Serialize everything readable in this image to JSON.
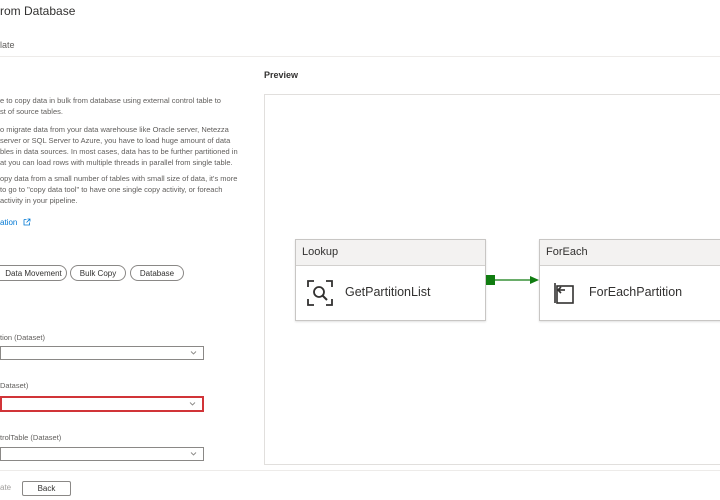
{
  "header": {
    "title": "rom Database",
    "subtitle": "late"
  },
  "description": {
    "lines": [
      "e to copy data in bulk from database using external control table to",
      "st of source tables.",
      "",
      "o migrate data from your data warehouse like Oracle server, Netezza",
      "server or SQL Server to Azure, you have to load huge amount of data",
      "bles in data sources. In most cases, data has to be further partitioned in",
      "at you can load rows with multiple threads in parallel from single table.",
      "",
      "opy data from a small number of tables with small size of data, it's more",
      "to go to \"copy data tool\" to have one single copy activity, or foreach",
      "activity in your pipeline."
    ],
    "doc_link": "ation"
  },
  "tags": [
    "Data Movement",
    "Bulk Copy",
    "Database"
  ],
  "fields": [
    {
      "top_label": "",
      "label": "tion (Dataset)",
      "value": ""
    },
    {
      "top_label": "",
      "label": "Dataset)",
      "value": ""
    },
    {
      "top_label": "",
      "label": "trolTable (Dataset)",
      "value": ""
    }
  ],
  "footer": {
    "use_label": "ate",
    "back_label": "Back"
  },
  "preview": {
    "title": "Preview",
    "activities": [
      {
        "type": "Lookup",
        "name": "GetPartitionList",
        "icon": "lookup-icon"
      },
      {
        "type": "ForEach",
        "name": "ForEachPartition",
        "icon": "foreach-icon"
      }
    ],
    "connector_color": "#107c10"
  },
  "colors": {
    "accent": "#0078d4",
    "error": "#d13438",
    "success": "#107c10"
  }
}
